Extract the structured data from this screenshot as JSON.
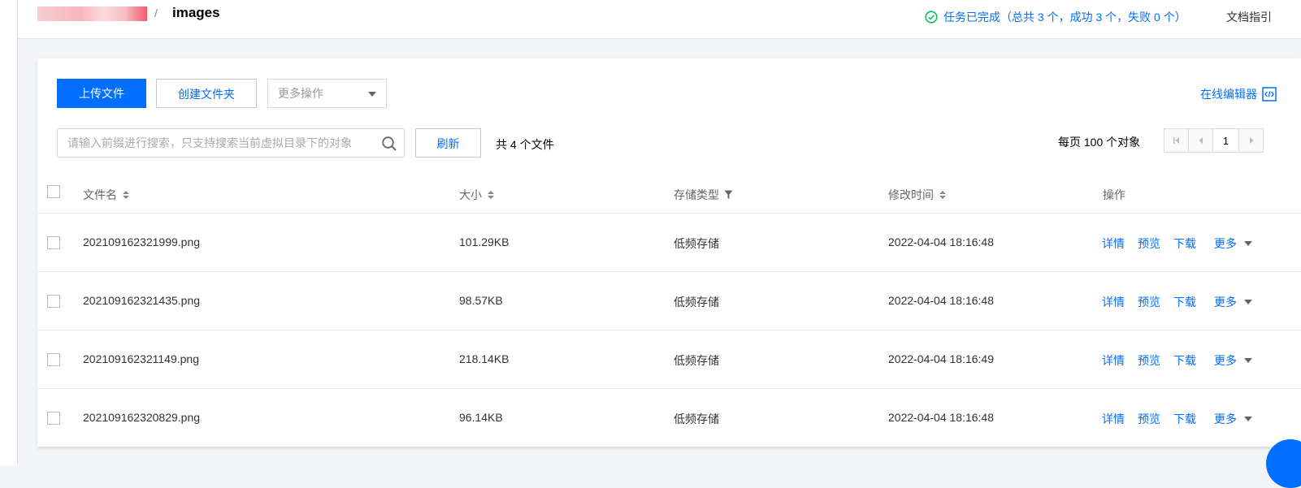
{
  "header": {
    "breadcrumb_current": "images",
    "breadcrumb_sep": "/",
    "task_status": "任务已完成（总共 3 个，成功 3 个，失败 0 个）",
    "doc_guide": "文档指引"
  },
  "toolbar": {
    "upload_label": "上传文件",
    "create_folder_label": "创建文件夹",
    "more_actions_label": "更多操作",
    "online_editor_label": "在线编辑器"
  },
  "search": {
    "placeholder": "请输入前缀进行搜索，只支持搜索当前虚拟目录下的对象",
    "refresh_label": "刷新",
    "file_count": "共 4 个文件"
  },
  "pagination": {
    "per_page_label": "每页 100 个对象",
    "current_page": "1"
  },
  "table": {
    "columns": {
      "name": "文件名",
      "size": "大小",
      "storage": "存储类型",
      "modified": "修改时间",
      "actions": "操作"
    },
    "rows": [
      {
        "name": "202109162321999.png",
        "size": "101.29KB",
        "storage": "低频存储",
        "modified": "2022-04-04 18:16:48"
      },
      {
        "name": "202109162321435.png",
        "size": "98.57KB",
        "storage": "低频存储",
        "modified": "2022-04-04 18:16:48"
      },
      {
        "name": "202109162321149.png",
        "size": "218.14KB",
        "storage": "低频存储",
        "modified": "2022-04-04 18:16:49"
      },
      {
        "name": "202109162320829.png",
        "size": "96.14KB",
        "storage": "低频存储",
        "modified": "2022-04-04 18:16:48"
      }
    ],
    "row_actions": {
      "details": "详情",
      "preview": "预览",
      "download": "下载",
      "more": "更多"
    }
  },
  "colors": {
    "primary": "#006eff",
    "success": "#0abf5b"
  }
}
